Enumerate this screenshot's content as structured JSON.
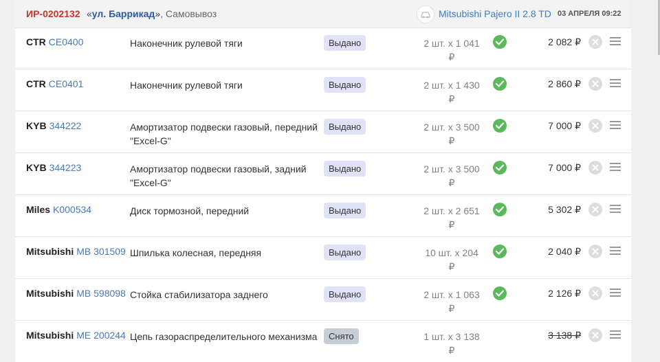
{
  "order": {
    "id": "ИР-0202132",
    "addr_quote_open": "«",
    "street": "ул. Баррикад",
    "addr_quote_close": "»",
    "method": ", Самовывоз",
    "car": "Mitsubishi Pajero II 2.8 TD",
    "date": "03 АПРЕЛЯ 09:22"
  },
  "icons": {
    "car": "car-icon",
    "check": "check-icon",
    "remove": "close-icon",
    "menu": "menu-icon"
  },
  "colors": {
    "issued_badge": "#e0e2f7",
    "removed_badge": "#c7cdd4",
    "check": "#5cb85c",
    "order_id": "#c0392b"
  },
  "rows": [
    {
      "brand": "CTR",
      "article": "CE0400",
      "name": "Наконечник рулевой тяги",
      "status": "Выдано",
      "qty": "2 шт. x 1 041",
      "cur": "₽",
      "sum": "2 082 ₽",
      "confirmed": true,
      "removed": false
    },
    {
      "brand": "CTR",
      "article": "CE0401",
      "name": "Наконечник рулевой тяги",
      "status": "Выдано",
      "qty": "2 шт. x 1 430",
      "cur": "₽",
      "sum": "2 860 ₽",
      "confirmed": true,
      "removed": false
    },
    {
      "brand": "KYB",
      "article": "344222",
      "name": "Амортизатор подвески газовый, передний \"Excel-G\"",
      "status": "Выдано",
      "qty": "2 шт. x 3 500",
      "cur": "₽",
      "sum": "7 000 ₽",
      "confirmed": true,
      "removed": false
    },
    {
      "brand": "KYB",
      "article": "344223",
      "name": "Амортизатор подвески газовый, задний \"Excel-G\"",
      "status": "Выдано",
      "qty": "2 шт. x 3 500",
      "cur": "₽",
      "sum": "7 000 ₽",
      "confirmed": true,
      "removed": false
    },
    {
      "brand": "Miles",
      "article": "K000534",
      "name": "Диск тормозной, передний",
      "status": "Выдано",
      "qty": "2 шт. x 2 651",
      "cur": "₽",
      "sum": "5 302 ₽",
      "confirmed": true,
      "removed": false
    },
    {
      "brand": "Mitsubishi",
      "article": "MB 301509",
      "name": "Шпилька колесная, передняя",
      "status": "Выдано",
      "qty": "10 шт. x 204",
      "cur": "₽",
      "sum": "2 040 ₽",
      "confirmed": true,
      "removed": false
    },
    {
      "brand": "Mitsubishi",
      "article": "MB 598098",
      "name": "Стойка стабилизатора заднего",
      "status": "Выдано",
      "qty": "2 шт. x 1 063",
      "cur": "₽",
      "sum": "2 126 ₽",
      "confirmed": true,
      "removed": false
    },
    {
      "brand": "Mitsubishi",
      "article": "ME 200244",
      "name": "Цепь газораспределительного механизма",
      "status": "Снято",
      "qty": "1 шт. x 3 138",
      "cur": "₽",
      "sum": "3 138 ₽",
      "confirmed": false,
      "removed": true
    }
  ]
}
